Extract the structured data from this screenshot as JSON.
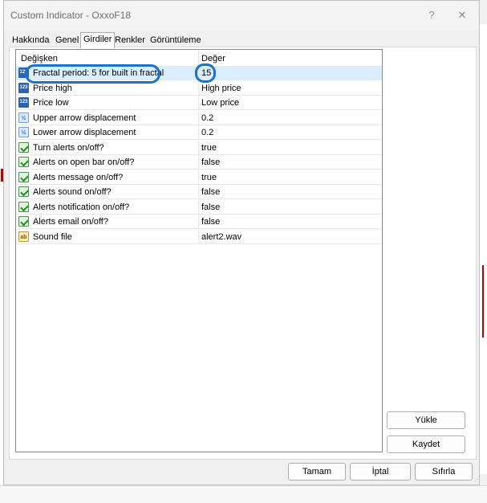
{
  "window": {
    "title": "Custom Indicator - OxxoF18",
    "help_label": "?",
    "close_label": "✕"
  },
  "tabs": [
    "Hakkında",
    "Genel",
    "Girdiler",
    "Renkler",
    "Görüntüleme"
  ],
  "active_tab": "Girdiler",
  "grid": {
    "column_variable": "Değişken",
    "column_value": "Değer",
    "rows": [
      {
        "icon": "integer-icon",
        "name": "Fractal period: 5 for built in fractal",
        "value": "15",
        "selected": true
      },
      {
        "icon": "integer-icon",
        "name": "Price high",
        "value": "High price"
      },
      {
        "icon": "integer-icon",
        "name": "Price low",
        "value": "Low price"
      },
      {
        "icon": "fraction-icon",
        "name": "Upper arrow displacement",
        "value": "0.2"
      },
      {
        "icon": "fraction-icon",
        "name": "Lower arrow displacement",
        "value": "0.2"
      },
      {
        "icon": "boolean-icon",
        "name": "Turn alerts on/off?",
        "value": "true"
      },
      {
        "icon": "boolean-icon",
        "name": "Alerts on open bar on/off?",
        "value": "false"
      },
      {
        "icon": "boolean-icon",
        "name": "Alerts message on/off?",
        "value": "true"
      },
      {
        "icon": "boolean-icon",
        "name": "Alerts sound on/off?",
        "value": "false"
      },
      {
        "icon": "boolean-icon",
        "name": "Alerts notification on/off?",
        "value": "false"
      },
      {
        "icon": "boolean-icon",
        "name": "Alerts email on/off?",
        "value": "false"
      },
      {
        "icon": "string-icon",
        "name": "Sound file",
        "value": "alert2.wav"
      }
    ]
  },
  "icon_glyphs": {
    "integer-icon": "123",
    "fraction-icon": "½",
    "string-icon": "ab"
  },
  "side_buttons": {
    "load": "Yükle",
    "save": "Kaydet"
  },
  "footer_buttons": {
    "ok": "Tamam",
    "cancel": "İptal",
    "reset": "Sıfırla"
  },
  "colors": {
    "selection": "#dbeeff",
    "annotation": "#1a72c9"
  }
}
